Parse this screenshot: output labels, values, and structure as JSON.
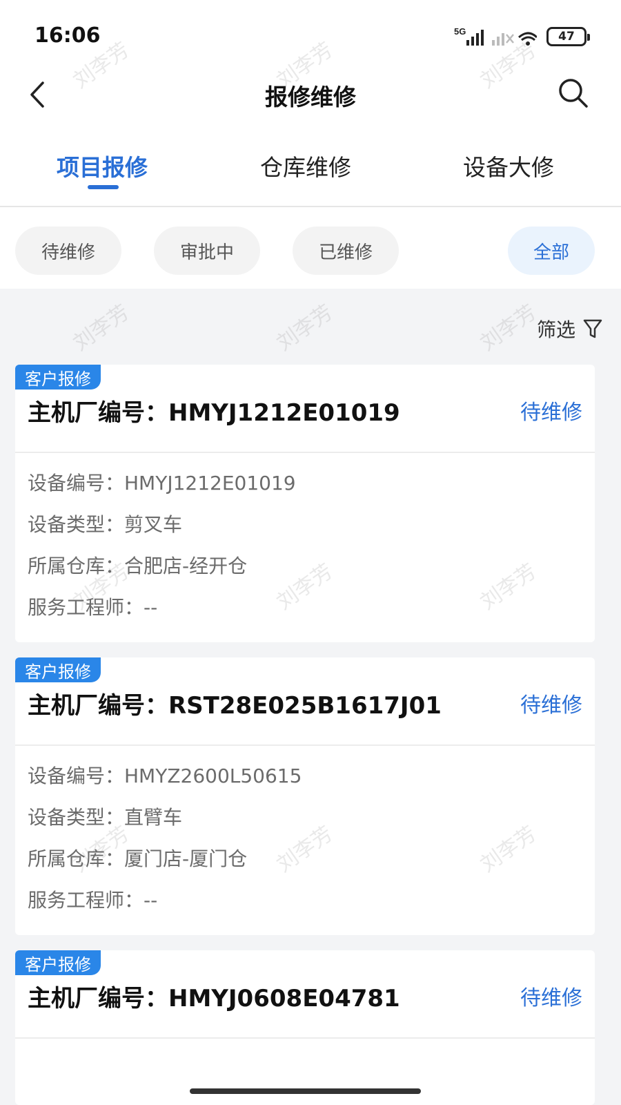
{
  "status_bar": {
    "time": "16:06",
    "network_label": "5G",
    "battery_level": "47",
    "wifi_sub": "6"
  },
  "header": {
    "title": "报修维修",
    "back_icon": "chevron-left-icon",
    "search_icon": "search-icon"
  },
  "tabs": [
    {
      "label": "项目报修",
      "active": true
    },
    {
      "label": "仓库维修",
      "active": false
    },
    {
      "label": "设备大修",
      "active": false
    }
  ],
  "status_filters": [
    {
      "label": "待维修",
      "active": false
    },
    {
      "label": "审批中",
      "active": false
    },
    {
      "label": "已维修",
      "active": false
    },
    {
      "label": "全部",
      "active": true
    }
  ],
  "filter": {
    "label": "筛选",
    "icon": "funnel-icon"
  },
  "cards": [
    {
      "tag": "客户报修",
      "title": "主机厂编号：HMYJ1212E01019",
      "status": "待维修",
      "rows": [
        "设备编号：HMYJ1212E01019",
        "设备类型：剪叉车",
        "所属仓库：合肥店-经开仓",
        "服务工程师：--"
      ]
    },
    {
      "tag": "客户报修",
      "title": "主机厂编号：RST28E025B1617J01",
      "status": "待维修",
      "rows": [
        "设备编号：HMYZ2600L50615",
        "设备类型：直臂车",
        "所属仓库：厦门店-厦门仓",
        "服务工程师：--"
      ]
    },
    {
      "tag": "客户报修",
      "title": "主机厂编号：HMYJ0608E04781",
      "status": "待维修",
      "rows": []
    }
  ],
  "watermark": "刘李芳",
  "colors": {
    "accent": "#2a6fd6",
    "tag_bg": "#2a86e8",
    "page_bg": "#f3f4f6"
  }
}
